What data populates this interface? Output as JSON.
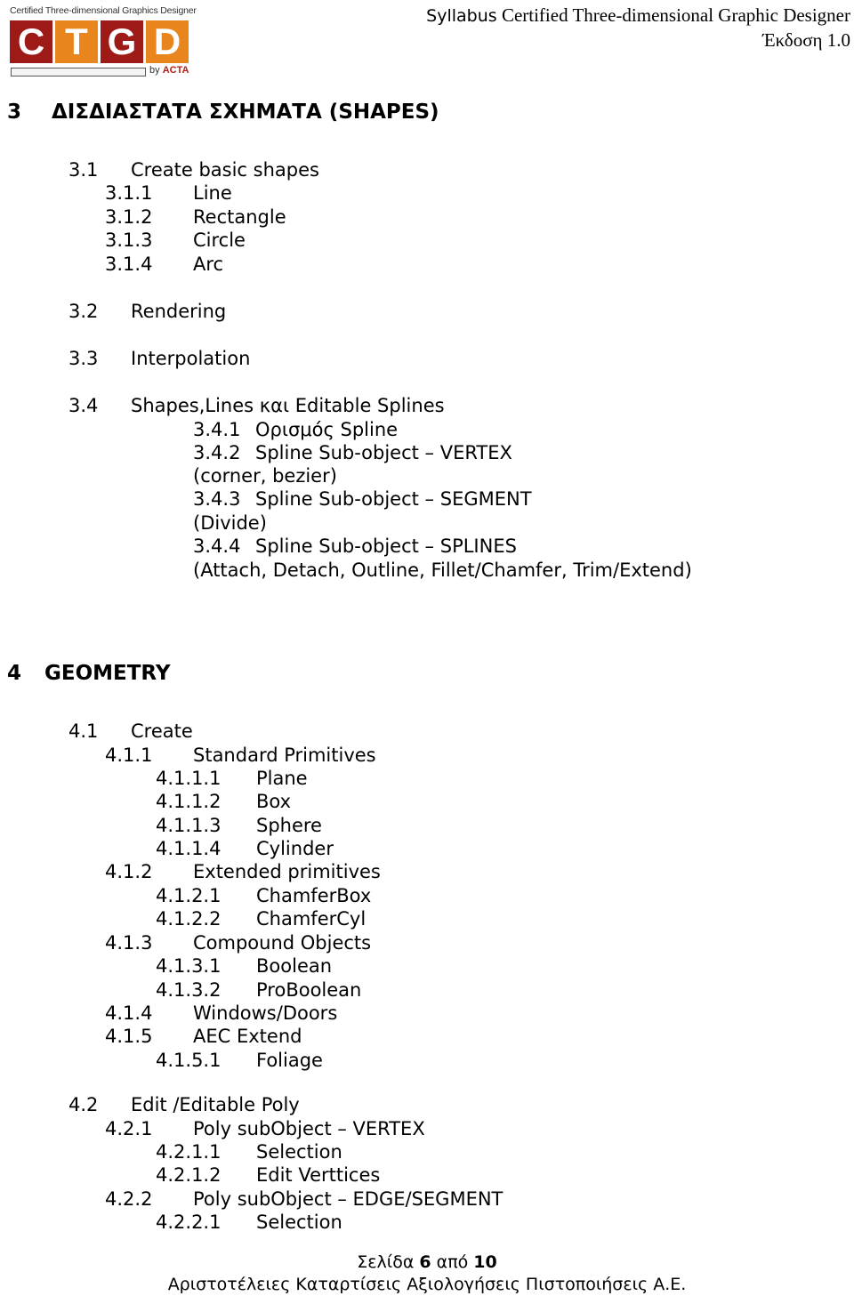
{
  "logo": {
    "tagline": "Certified Three-dimensional Graphics  Designer",
    "letters": [
      "C",
      "T",
      "G",
      "D"
    ],
    "by_prefix": "by",
    "by_org": "ACTA",
    "colors": {
      "red": "#9e1a17",
      "orange": "#e8861d"
    }
  },
  "header": {
    "title_sans": "Syllabus",
    "title_serif": " Certified Three-dimensional Graphic Designer",
    "version": "Έκδοση 1.0"
  },
  "sections": [
    {
      "number": "3",
      "title": "ΔΙΣΔΙΑΣΤΑΤΑ ΣΧΗΜΑΤΑ (SHAPES)",
      "items": [
        {
          "num": "3.1",
          "label": "Create basic shapes"
        },
        {
          "num": "3.1.1",
          "label": "Line"
        },
        {
          "num": "3.1.2",
          "label": "Rectangle"
        },
        {
          "num": "3.1.3",
          "label": "Circle"
        },
        {
          "num": "3.1.4",
          "label": "Arc"
        },
        {
          "num": "3.2",
          "label": "Rendering"
        },
        {
          "num": "3.3",
          "label": "Interpolation"
        },
        {
          "num": "3.4",
          "label": "Shapes,Lines και Editable Splines"
        },
        {
          "num": "3.4.1",
          "label": "Ορισμός Spline"
        },
        {
          "num": "3.4.2",
          "label": "Spline Sub-object – VERTEX"
        },
        {
          "num": "",
          "label": "(corner, bezier)"
        },
        {
          "num": "3.4.3",
          "label": "Spline Sub-object – SEGMENT"
        },
        {
          "num": "",
          "label": "(Divide)"
        },
        {
          "num": "3.4.4",
          "label": "Spline Sub-object – SPLINES"
        },
        {
          "num": "",
          "label": "(Attach, Detach, Outline, Fillet/Chamfer, Trim/Extend)"
        }
      ]
    },
    {
      "number": "4",
      "title": "GEOMETRY",
      "items": [
        {
          "num": "4.1",
          "label": "Create"
        },
        {
          "num": "4.1.1",
          "label": "Standard Primitives"
        },
        {
          "num": "4.1.1.1",
          "label": "Plane"
        },
        {
          "num": "4.1.1.2",
          "label": "Box"
        },
        {
          "num": "4.1.1.3",
          "label": "Sphere"
        },
        {
          "num": "4.1.1.4",
          "label": "Cylinder"
        },
        {
          "num": "4.1.2",
          "label": "Extended primitives"
        },
        {
          "num": "4.1.2.1",
          "label": "ChamferBox"
        },
        {
          "num": "4.1.2.2",
          "label": "ChamferCyl"
        },
        {
          "num": "4.1.3",
          "label": "Compound Objects"
        },
        {
          "num": "4.1.3.1",
          "label": "Boolean"
        },
        {
          "num": "4.1.3.2",
          "label": "ProBoolean"
        },
        {
          "num": "4.1.4",
          "label": "Windows/Doors"
        },
        {
          "num": "4.1.5",
          "label": "AEC Extend"
        },
        {
          "num": "4.1.5.1",
          "label": "Foliage"
        },
        {
          "num": "4.2",
          "label": "Edit /Editable Poly"
        },
        {
          "num": "4.2.1",
          "label": "Poly subObject – VERTEX"
        },
        {
          "num": "4.2.1.1",
          "label": "Selection"
        },
        {
          "num": "4.2.1.2",
          "label": "Edit Verttices"
        },
        {
          "num": "4.2.2",
          "label": "Poly subObject – EDGE/SEGMENT"
        },
        {
          "num": "4.2.2.1",
          "label": "Selection"
        }
      ]
    }
  ],
  "footer": {
    "page_prefix": "Σελίδα ",
    "page_current": "6",
    "page_sep": " από ",
    "page_total": "10",
    "company": "Αριστοτέλειες Καταρτίσεις Αξιολογήσεις  Πιστοποιήσεις Α.Ε."
  }
}
